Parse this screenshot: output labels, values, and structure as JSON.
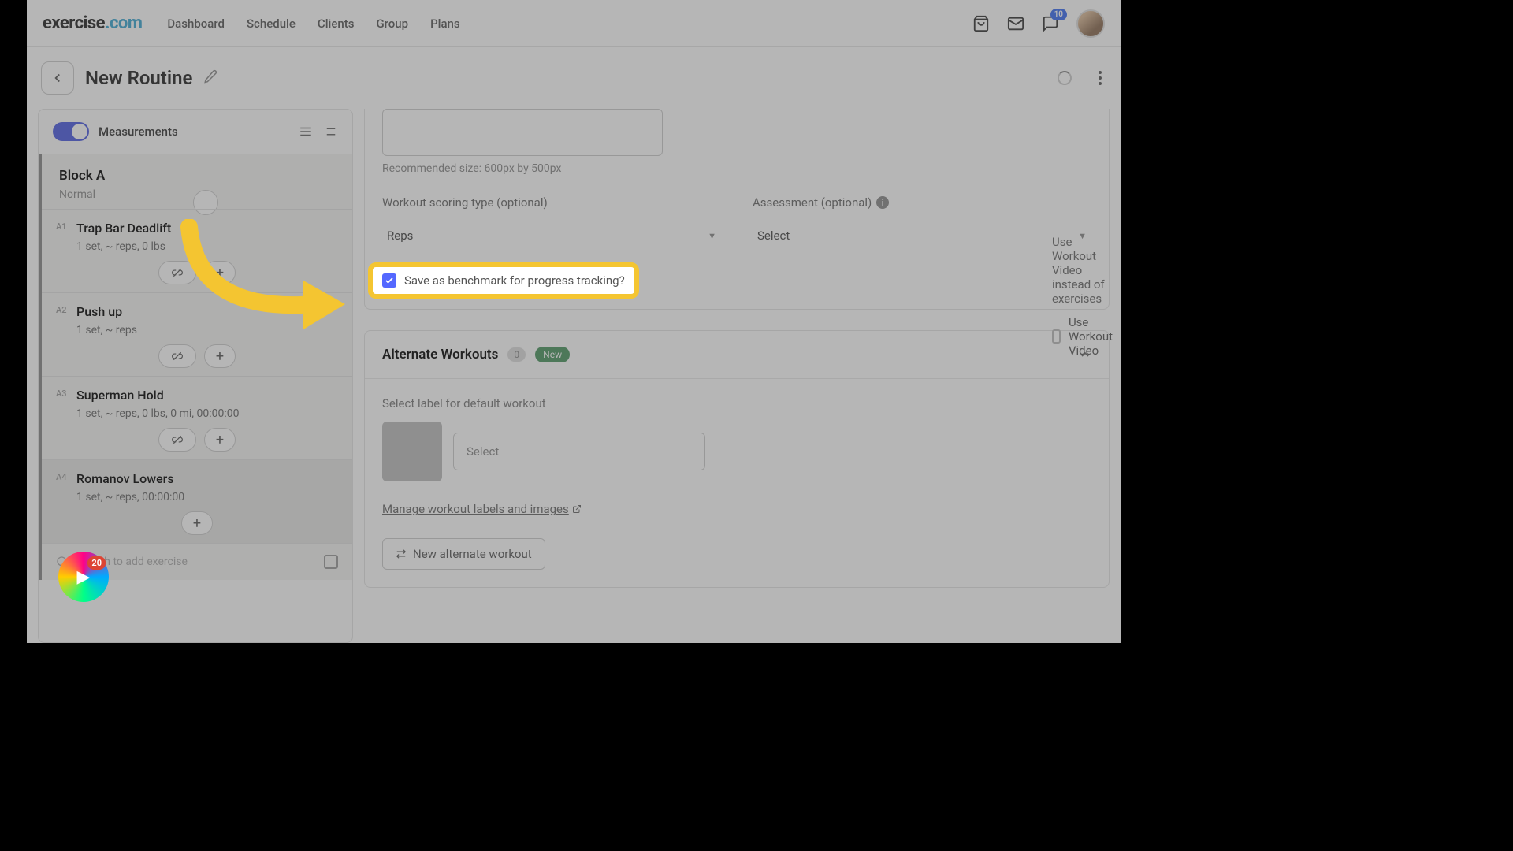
{
  "brand": {
    "part1": "exercise",
    "part2": ".com"
  },
  "nav": {
    "dashboard": "Dashboard",
    "schedule": "Schedule",
    "clients": "Clients",
    "group": "Group",
    "plans": "Plans",
    "notif_count": "10"
  },
  "header": {
    "title": "New Routine"
  },
  "sidebar": {
    "measurements": "Measurements",
    "block": {
      "title": "Block A",
      "subtitle": "Normal"
    },
    "exercises": [
      {
        "idx": "A1",
        "name": "Trap Bar Deadlift",
        "detail": "1 set, ~  reps, 0  lbs"
      },
      {
        "idx": "A2",
        "name": "Push up",
        "detail": "1 set, ~  reps"
      },
      {
        "idx": "A3",
        "name": "Superman Hold",
        "detail": "1 set, ~  reps, 0  lbs, 0  mi, 00:00:00"
      },
      {
        "idx": "A4",
        "name": "Romanov Lowers",
        "detail": "1 set, ~  reps, 00:00:00"
      }
    ],
    "search_placeholder": "Search to add exercise"
  },
  "main": {
    "rec_size": "Recommended size: 600px by 500px",
    "video_hint": "Use Workout Video instead of exercises",
    "video_check": "Use Workout Video",
    "scoring_label": "Workout scoring type (optional)",
    "scoring_value": "Reps",
    "assessment_label": "Assessment (optional)",
    "assessment_value": "Select",
    "benchmark": "Save as benchmark for progress tracking?",
    "alt": {
      "title": "Alternate Workouts",
      "count": "0",
      "new_badge": "New",
      "select_label_hint": "Select label for default workout",
      "select_placeholder": "Select",
      "manage_link": "Manage workout labels and images",
      "new_btn": "New alternate workout"
    }
  },
  "float_badge": "20"
}
